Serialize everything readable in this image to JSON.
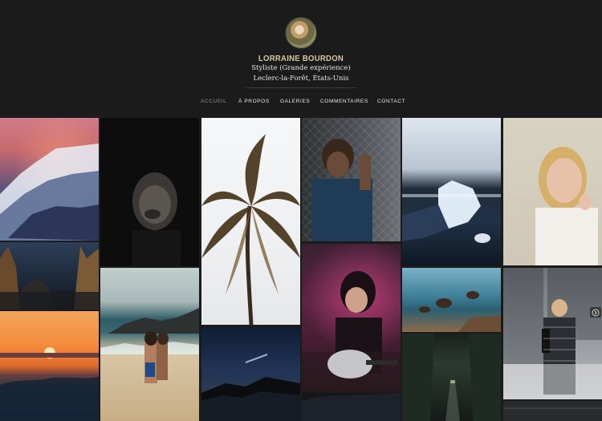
{
  "profile": {
    "name": "LORRAINE BOURDON",
    "subtitle": "Styliste (Grande expérience)",
    "location": "Leclerc-la-Forêt, États-Unis"
  },
  "nav": {
    "items": [
      "ACCUEIL",
      "À PROPOS",
      "GALERIES",
      "COMMENTAIRES",
      "CONTACT"
    ],
    "active_index": 0
  },
  "gallery": {
    "photos": [
      "mountain-sunset",
      "portrait-dark",
      "palm-tree",
      "man-fence",
      "ice-in-hand",
      "blonde-portrait",
      "mountain-forest-night",
      "couple-beach",
      "comet-night",
      "singer-guitar",
      "rocky-coast",
      "man-backpack-city",
      "ocean-sunset",
      "forest-road"
    ]
  },
  "colors": {
    "background": "#1b1b1b",
    "name_accent": "#d7c7a5",
    "nav_active": "#8f8f8f"
  },
  "icons": {
    "share": "share-icon"
  }
}
